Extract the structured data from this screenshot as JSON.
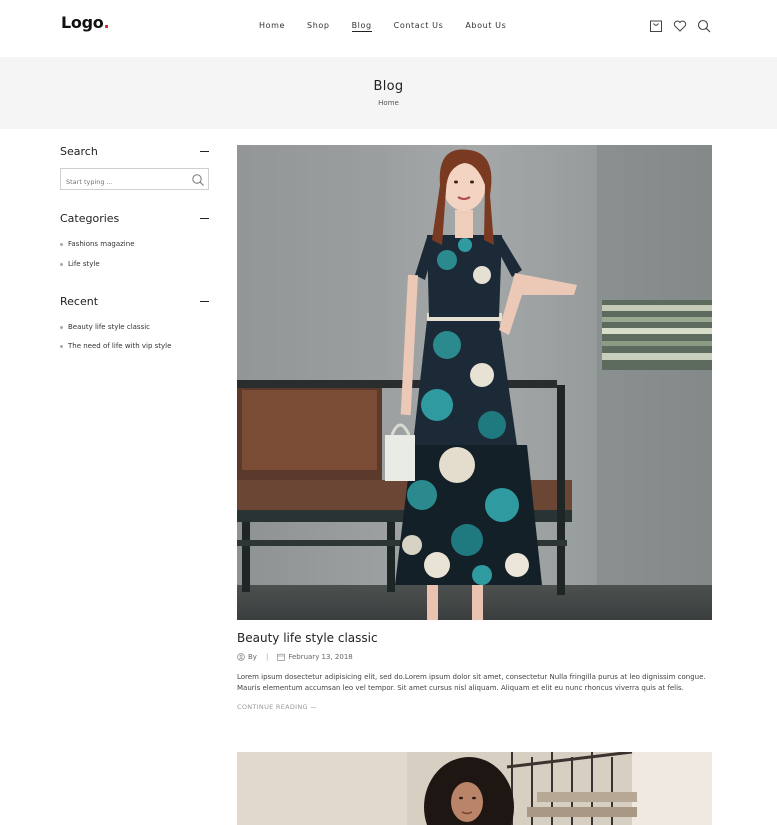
{
  "header": {
    "logo_text": "Logo",
    "logo_dot": ".",
    "nav": [
      {
        "label": "Home",
        "active": false
      },
      {
        "label": "Shop",
        "active": false
      },
      {
        "label": "Blog",
        "active": true
      },
      {
        "label": "Contact Us",
        "active": false
      },
      {
        "label": "About Us",
        "active": false
      }
    ],
    "icons": [
      "cart-icon",
      "heart-icon",
      "search-icon"
    ]
  },
  "banner": {
    "title": "Blog",
    "breadcrumb": "Home"
  },
  "sidebar": {
    "search": {
      "title": "Search",
      "placeholder": "Start typing ..."
    },
    "categories": {
      "title": "Categories",
      "items": [
        "Fashions magazine",
        "Life style"
      ]
    },
    "recent": {
      "title": "Recent",
      "items": [
        "Beauty life style classic",
        "The need of life with vip style"
      ]
    }
  },
  "posts": [
    {
      "title": "Beauty life style classic",
      "author_prefix": "By",
      "separator": "|",
      "date": "February 13, 2018",
      "excerpt": "Lorem ipsum dosectetur adipisicing elit, sed do.Lorem ipsum dolor sit amet, consectetur Nulla fringilla purus at leo dignissim congue. Mauris elementum accumsan leo vel tempor. Sit amet cursus nisl aliquam. Aliquam et elit eu nunc rhoncus viverra quis at felis.",
      "read_more": "CONTINUE READING —"
    }
  ],
  "colors": {
    "accent_dot": "#c8282e",
    "banner_bg": "#f5f5f5",
    "text": "#222222"
  }
}
